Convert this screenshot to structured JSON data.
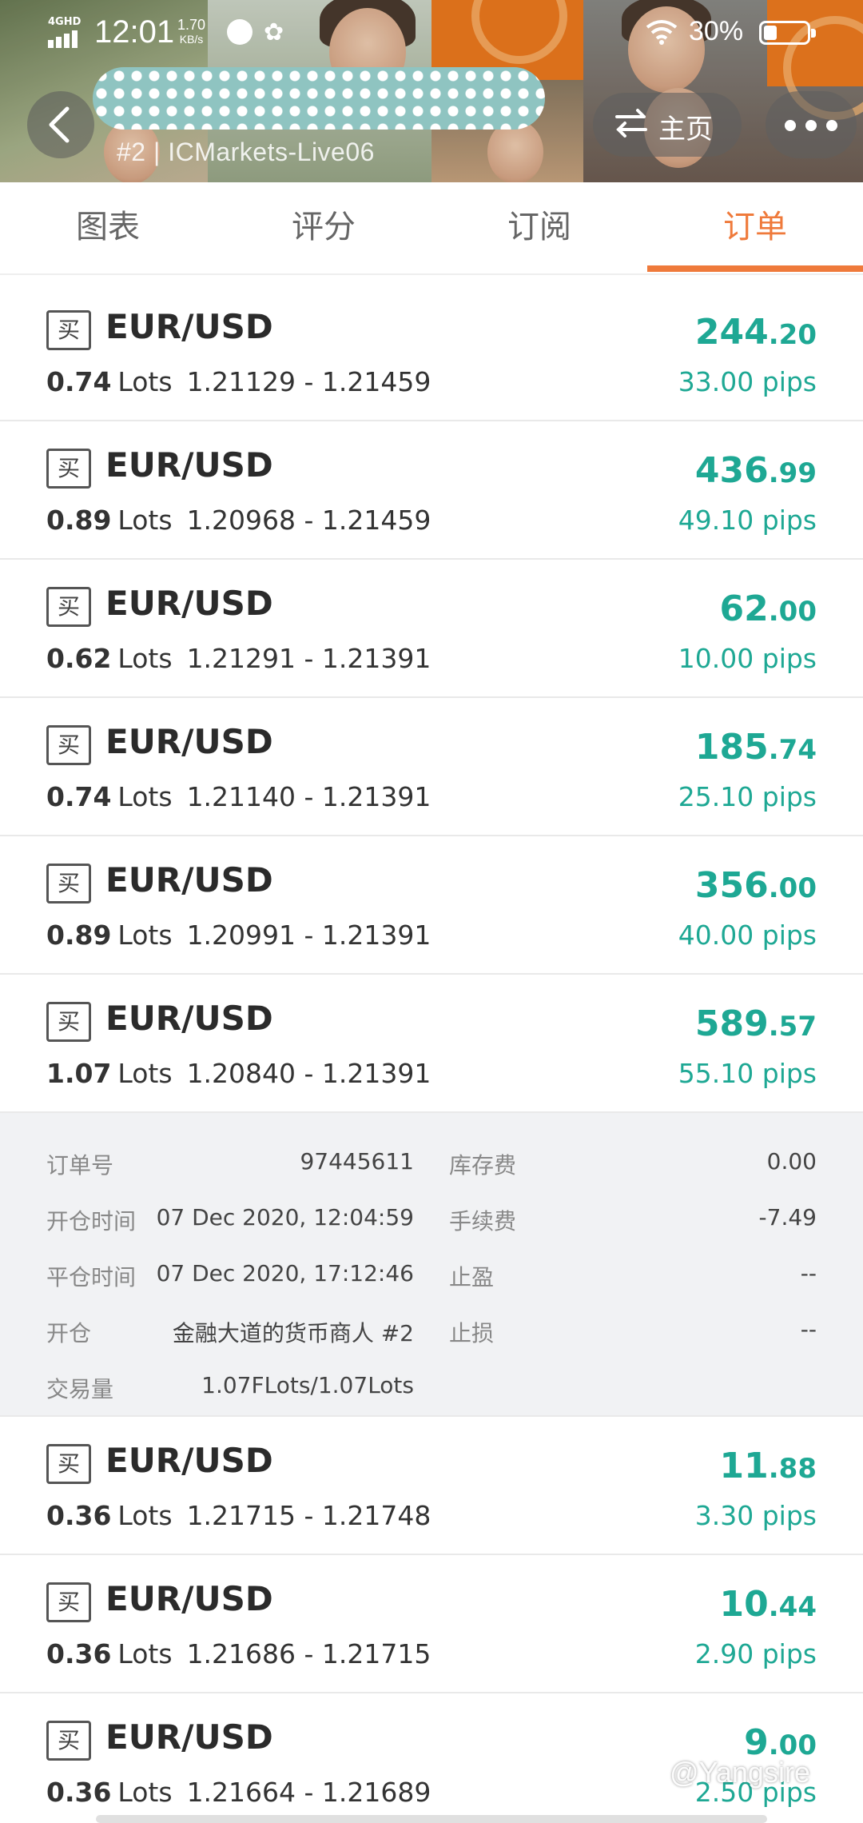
{
  "status_bar": {
    "network": "4GHD",
    "time": "12:01",
    "speed_value": "1.70",
    "speed_unit": "KB/s",
    "battery_percent": "30%",
    "battery_level": 0.3
  },
  "header": {
    "account": "#2 | ICMarkets-Live06",
    "home_label": "主页",
    "back_icon": "chevron-left-icon",
    "more_icon": "more-dots-icon",
    "swap_icon": "swap-arrows-icon"
  },
  "tabs": [
    {
      "label": "图表",
      "active": false
    },
    {
      "label": "评分",
      "active": false
    },
    {
      "label": "订阅",
      "active": false
    },
    {
      "label": "订单",
      "active": true
    }
  ],
  "colors": {
    "accent": "#ef7a3b",
    "profit": "#1ea894",
    "details_bg": "#f1f2f4"
  },
  "orders": [
    {
      "type": "买",
      "symbol": "EUR/USD",
      "lots": "0.74",
      "lots_word": "Lots",
      "prices": "1.21129 - 1.21459",
      "profit_int": "244",
      "profit_dec": ".20",
      "pips": "33.00 pips"
    },
    {
      "type": "买",
      "symbol": "EUR/USD",
      "lots": "0.89",
      "lots_word": "Lots",
      "prices": "1.20968 - 1.21459",
      "profit_int": "436",
      "profit_dec": ".99",
      "pips": "49.10 pips"
    },
    {
      "type": "买",
      "symbol": "EUR/USD",
      "lots": "0.62",
      "lots_word": "Lots",
      "prices": "1.21291 - 1.21391",
      "profit_int": "62",
      "profit_dec": ".00",
      "pips": "10.00 pips"
    },
    {
      "type": "买",
      "symbol": "EUR/USD",
      "lots": "0.74",
      "lots_word": "Lots",
      "prices": "1.21140 - 1.21391",
      "profit_int": "185",
      "profit_dec": ".74",
      "pips": "25.10 pips"
    },
    {
      "type": "买",
      "symbol": "EUR/USD",
      "lots": "0.89",
      "lots_word": "Lots",
      "prices": "1.20991 - 1.21391",
      "profit_int": "356",
      "profit_dec": ".00",
      "pips": "40.00 pips"
    },
    {
      "type": "买",
      "symbol": "EUR/USD",
      "lots": "1.07",
      "lots_word": "Lots",
      "prices": "1.20840 - 1.21391",
      "profit_int": "589",
      "profit_dec": ".57",
      "pips": "55.10 pips"
    },
    {
      "type": "买",
      "symbol": "EUR/USD",
      "lots": "0.36",
      "lots_word": "Lots",
      "prices": "1.21715 - 1.21748",
      "profit_int": "11",
      "profit_dec": ".88",
      "pips": "3.30 pips"
    },
    {
      "type": "买",
      "symbol": "EUR/USD",
      "lots": "0.36",
      "lots_word": "Lots",
      "prices": "1.21686 - 1.21715",
      "profit_int": "10",
      "profit_dec": ".44",
      "pips": "2.90 pips"
    },
    {
      "type": "买",
      "symbol": "EUR/USD",
      "lots": "0.36",
      "lots_word": "Lots",
      "prices": "1.21664 - 1.21689",
      "profit_int": "9",
      "profit_dec": ".00",
      "pips": "2.50 pips"
    }
  ],
  "details": {
    "order_no_label": "订单号",
    "order_no": "97445611",
    "swap_label": "库存费",
    "swap": "0.00",
    "open_time_label": "开仓时间",
    "open_time": "07 Dec 2020, 12:04:59",
    "commission_label": "手续费",
    "commission": "-7.49",
    "close_time_label": "平仓时间",
    "close_time": "07 Dec 2020, 17:12:46",
    "tp_label": "止盈",
    "tp": "--",
    "opener_label": "开仓",
    "opener": "金融大道的货币商人 #2",
    "sl_label": "止损",
    "sl": "--",
    "volume_label": "交易量",
    "volume": "1.07FLots/1.07Lots"
  },
  "watermark": "@Yangsire"
}
